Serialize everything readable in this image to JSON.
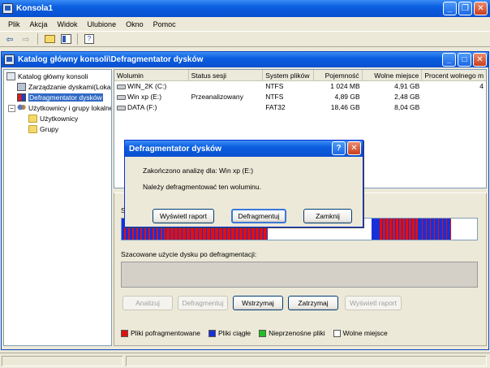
{
  "outer_window": {
    "title": "Konsola1",
    "icon": "console-app-icon"
  },
  "menu": [
    "Plik",
    "Akcja",
    "Widok",
    "Ulubione",
    "Okno",
    "Pomoc"
  ],
  "toolbar": [
    "back-arrow-icon",
    "forward-arrow-icon",
    "up-folder-icon",
    "show-hide-tree-icon",
    "properties-help-icon"
  ],
  "inner_window": {
    "title": "Katalog główny konsoli\\Defragmentator dysków"
  },
  "tree": {
    "items": [
      {
        "label": "Katalog główny konsoli",
        "icon": "console-root-icon",
        "level": 0
      },
      {
        "label": "Zarządzanie dyskami(Lokal",
        "icon": "disk-management-icon",
        "level": 1
      },
      {
        "label": "Defragmentator dysków",
        "icon": "defragmenter-icon",
        "level": 1,
        "selected": true
      },
      {
        "label": "Użytkownicy i grupy lokalne",
        "icon": "users-groups-icon",
        "level": 1,
        "expanded": true
      },
      {
        "label": "Użytkownicy",
        "icon": "folder-icon",
        "level": 2
      },
      {
        "label": "Grupy",
        "icon": "folder-icon",
        "level": 2
      }
    ]
  },
  "volumes": {
    "columns": [
      "Wolumin",
      "Status sesji",
      "System plików",
      "Pojemność",
      "Wolne miejsce",
      "Procent wolnego m"
    ],
    "rows": [
      {
        "volume": "WIN_2K (C:)",
        "status": "",
        "fs": "NTFS",
        "capacity": "1 024 MB",
        "free": "4,91 GB",
        "percent": "4"
      },
      {
        "volume": "Win xp (E:)",
        "status": "Przeanalizowany",
        "fs": "NTFS",
        "capacity": "4,89 GB",
        "free": "2,48 GB",
        "percent": ""
      },
      {
        "volume": "DATA (F:)",
        "status": "",
        "fs": "FAT32",
        "capacity": "18,46 GB",
        "free": "8,04 GB",
        "percent": ""
      }
    ]
  },
  "lower": {
    "analysis_label_fragment": "S",
    "estimated_label": "Szacowane użycie dysku po defragmentacji:",
    "buttons": [
      {
        "label": "Analizuj",
        "enabled": false
      },
      {
        "label": "Defragmentuj",
        "enabled": false
      },
      {
        "label": "Wstrzymaj",
        "enabled": true
      },
      {
        "label": "Zatrzymaj",
        "enabled": true
      },
      {
        "label": "Wyświetl raport",
        "enabled": false
      }
    ],
    "legend": [
      {
        "label": "Pliki pofragmentowane",
        "color": "#e01010"
      },
      {
        "label": "Pliki ciągłe",
        "color": "#1830d8"
      },
      {
        "label": "Nieprzenośne pliki",
        "color": "#20c020"
      },
      {
        "label": "Wolne miejsce",
        "color": "#ffffff"
      }
    ]
  },
  "dialog": {
    "title": "Defragmentator dysków",
    "line1": "Zakończono analizę dla: Win xp (E:)",
    "line2": "Należy defragmentować ten woluminu.",
    "buttons": [
      "Wyświetl raport",
      "Defragmentuj",
      "Zamknij"
    ],
    "title_buttons": [
      "help-icon",
      "close-icon"
    ]
  }
}
